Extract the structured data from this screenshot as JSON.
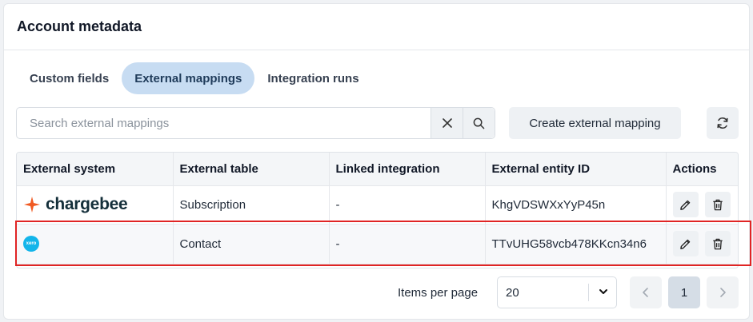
{
  "card": {
    "title": "Account metadata"
  },
  "tabs": [
    {
      "label": "Custom fields",
      "active": false
    },
    {
      "label": "External mappings",
      "active": true
    },
    {
      "label": "Integration runs",
      "active": false
    }
  ],
  "search": {
    "placeholder": "Search external mappings",
    "value": ""
  },
  "toolbar": {
    "create_label": "Create external mapping"
  },
  "table": {
    "headers": [
      "External system",
      "External table",
      "Linked integration",
      "External entity ID",
      "Actions"
    ],
    "rows": [
      {
        "system_logo": "chargebee",
        "system_text": "chargebee",
        "table": "Subscription",
        "integration": "-",
        "entity_id": "KhgVDSWXxYyP45n"
      },
      {
        "system_logo": "xero",
        "system_text": "xero",
        "table": "Contact",
        "integration": "-",
        "entity_id": "TTvUHG58vcb478KKcn34n6"
      }
    ]
  },
  "pagination": {
    "items_per_page_label": "Items per page",
    "items_per_page": "20",
    "current_page": "1"
  },
  "colors": {
    "active_tab": "#c7dcf2",
    "highlight": "#e02424",
    "chargebee": "#f05a22",
    "xero": "#13b5ea"
  },
  "icons": [
    "clear-icon",
    "search-icon",
    "refresh-icon",
    "edit-icon",
    "trash-icon",
    "chevron-down-icon",
    "chevron-left-icon",
    "chevron-right-icon"
  ]
}
